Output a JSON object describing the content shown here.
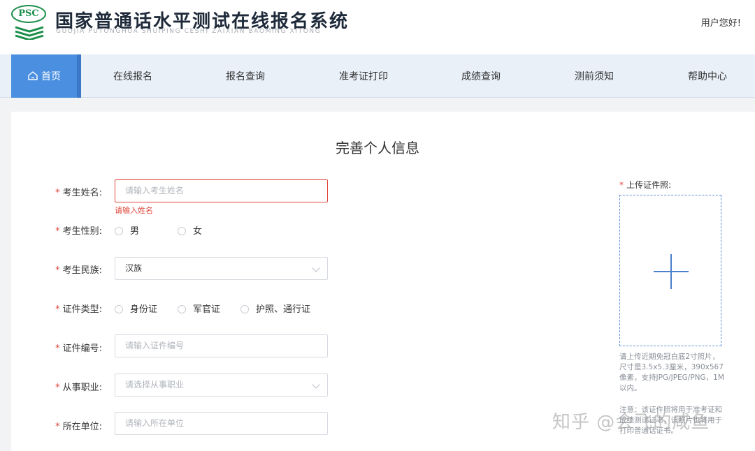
{
  "header": {
    "logo_text": "PSC",
    "title": "国家普通话水平测试在线报名系统",
    "subtitle": "GUOJIA PUTONGHUA SHUIPING CESHI ZAIXIAN BAOMING XITONG",
    "greeting": "用户您好!"
  },
  "nav": {
    "items": [
      {
        "label": "首页",
        "icon": "home-icon",
        "active": true
      },
      {
        "label": "在线报名"
      },
      {
        "label": "报名查询"
      },
      {
        "label": "准考证打印"
      },
      {
        "label": "成绩查询"
      },
      {
        "label": "测前须知"
      },
      {
        "label": "帮助中心"
      }
    ]
  },
  "form": {
    "title": "完善个人信息",
    "required_mark": "*",
    "name": {
      "label": "考生姓名:",
      "placeholder": "请输入考生姓名",
      "error": "请输入姓名"
    },
    "gender": {
      "label": "考生性别:",
      "options": [
        "男",
        "女"
      ]
    },
    "ethnicity": {
      "label": "考生民族:",
      "value": "汉族"
    },
    "id_type": {
      "label": "证件类型:",
      "options": [
        "身份证",
        "军官证",
        "护照、通行证"
      ]
    },
    "id_number": {
      "label": "证件编号:",
      "placeholder": "请输入证件编号"
    },
    "occupation": {
      "label": "从事职业:",
      "placeholder": "请选择从事职业"
    },
    "employer": {
      "label": "所在单位:",
      "placeholder": "请输入所在单位"
    }
  },
  "photo": {
    "label": "上传证件照:",
    "description": "请上传近期免冠白底2寸照片，尺寸是3.5x5.3厘米，390x567像素，支持JPG/JPEG/PNG，1M以内。",
    "note": "注意：该证件照将用于准考证和成绩测试证书，该照片也将用于打印普通话证书。"
  },
  "watermark": "知乎 @会飞的咸鱼",
  "colors": {
    "accent": "#4a8fe0",
    "error": "#e0483d",
    "brand_green": "#1a8f4a"
  }
}
